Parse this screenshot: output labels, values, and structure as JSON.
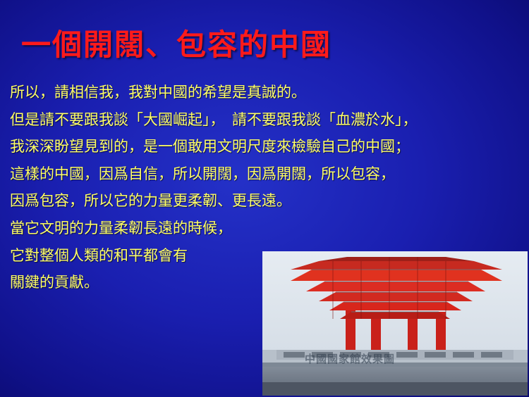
{
  "slide": {
    "title": "一個開闊、包容的中國",
    "lines": [
      "所以，請相信我，我對中國的希望是真誠的。",
      "但是請不要跟我談「大國崛起」，　請不要跟我談「血濃於水」，",
      "我深深盼望見到的，是一個敢用文明尺度來檢驗自己的中國；",
      "這樣的中國，因爲自信，所以開闊，因爲開闊，所以包容，",
      "因爲包容，所以它的力量更柔韌、更長遠。",
      "當它文明的力量柔韌長遠的時候，",
      "它對整個人類的和平都會有",
      "關鍵的貢獻。"
    ]
  },
  "photo": {
    "icon": "china-pavilion-photo",
    "caption": "中國國家館效果圖"
  },
  "colors": {
    "background": "#1a1fb0",
    "title": "#ff1a1a",
    "body_text": "#ffff66",
    "pavilion_red": "#d8261c"
  }
}
